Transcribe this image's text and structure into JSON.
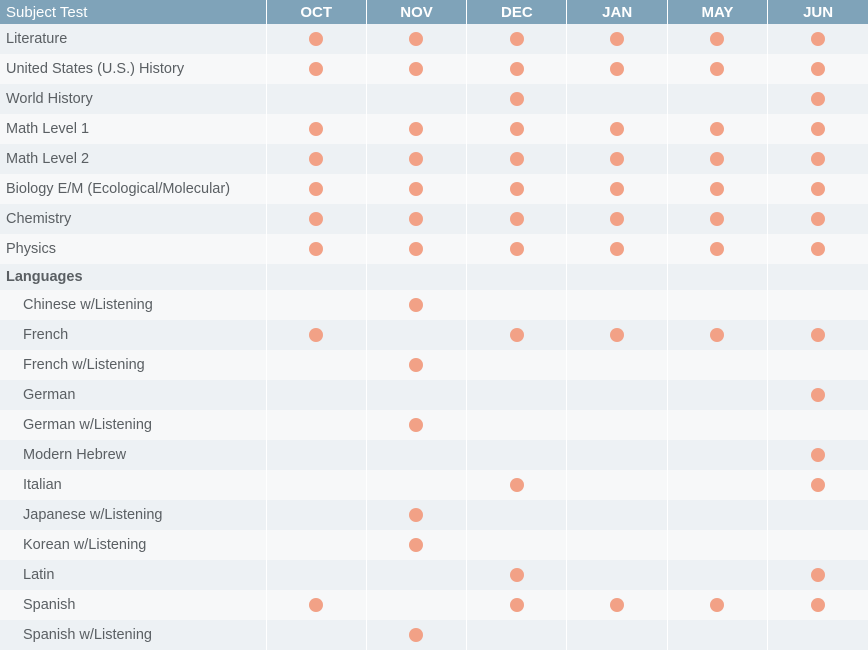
{
  "table": {
    "header": {
      "subject_label": "Subject Test",
      "months": [
        "OCT",
        "NOV",
        "DEC",
        "JAN",
        "MAY",
        "JUN"
      ]
    },
    "rows": [
      {
        "subject": "Literature",
        "type": "subject",
        "availability": [
          true,
          true,
          true,
          true,
          true,
          true
        ]
      },
      {
        "subject": "United States (U.S.) History",
        "type": "subject",
        "availability": [
          true,
          true,
          true,
          true,
          true,
          true
        ]
      },
      {
        "subject": "World History",
        "type": "subject",
        "availability": [
          false,
          false,
          true,
          false,
          false,
          true
        ]
      },
      {
        "subject": "Math Level 1",
        "type": "subject",
        "availability": [
          true,
          true,
          true,
          true,
          true,
          true
        ]
      },
      {
        "subject": "Math Level 2",
        "type": "subject",
        "availability": [
          true,
          true,
          true,
          true,
          true,
          true
        ]
      },
      {
        "subject": "Biology E/M (Ecological/Molecular)",
        "type": "subject",
        "availability": [
          true,
          true,
          true,
          true,
          true,
          true
        ]
      },
      {
        "subject": "Chemistry",
        "type": "subject",
        "availability": [
          true,
          true,
          true,
          true,
          true,
          true
        ]
      },
      {
        "subject": "Physics",
        "type": "subject",
        "availability": [
          true,
          true,
          true,
          true,
          true,
          true
        ]
      },
      {
        "subject": "Languages",
        "type": "group",
        "availability": [
          false,
          false,
          false,
          false,
          false,
          false
        ]
      },
      {
        "subject": "Chinese w/Listening",
        "type": "language",
        "availability": [
          false,
          true,
          false,
          false,
          false,
          false
        ]
      },
      {
        "subject": "French",
        "type": "language",
        "availability": [
          true,
          false,
          true,
          true,
          true,
          true
        ]
      },
      {
        "subject": "French w/Listening",
        "type": "language",
        "availability": [
          false,
          true,
          false,
          false,
          false,
          false
        ]
      },
      {
        "subject": "German",
        "type": "language",
        "availability": [
          false,
          false,
          false,
          false,
          false,
          true
        ]
      },
      {
        "subject": "German w/Listening",
        "type": "language",
        "availability": [
          false,
          true,
          false,
          false,
          false,
          false
        ]
      },
      {
        "subject": "Modern Hebrew",
        "type": "language",
        "availability": [
          false,
          false,
          false,
          false,
          false,
          true
        ]
      },
      {
        "subject": "Italian",
        "type": "language",
        "availability": [
          false,
          false,
          true,
          false,
          false,
          true
        ]
      },
      {
        "subject": "Japanese w/Listening",
        "type": "language",
        "availability": [
          false,
          true,
          false,
          false,
          false,
          false
        ]
      },
      {
        "subject": "Korean w/Listening",
        "type": "language",
        "availability": [
          false,
          true,
          false,
          false,
          false,
          false
        ]
      },
      {
        "subject": "Latin",
        "type": "language",
        "availability": [
          false,
          false,
          true,
          false,
          false,
          true
        ]
      },
      {
        "subject": "Spanish",
        "type": "language",
        "availability": [
          true,
          false,
          true,
          true,
          true,
          true
        ]
      },
      {
        "subject": "Spanish w/Listening",
        "type": "language",
        "availability": [
          false,
          true,
          false,
          false,
          false,
          false
        ]
      }
    ]
  },
  "colors": {
    "header_background": "#7fa3b9",
    "header_text": "#ffffff",
    "row_background_odd": "#edf1f4",
    "row_background_even": "#f7f8f9",
    "subject_text": "#5a5f63",
    "availability_dot": "#f2a186"
  },
  "icons": {
    "availability_marker": "availability-dot-icon"
  }
}
